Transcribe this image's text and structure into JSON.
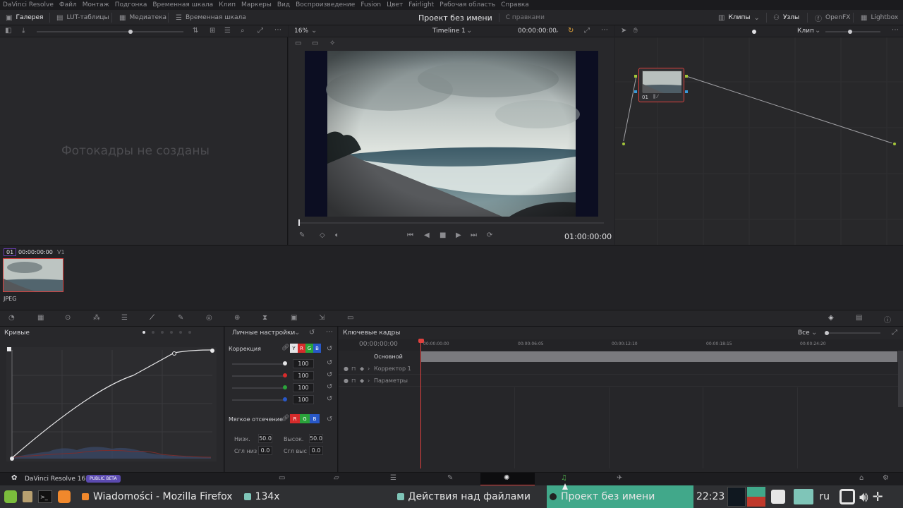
{
  "menu": [
    "DaVinci Resolve",
    "Файл",
    "Монтаж",
    "Подгонка",
    "Временная шкала",
    "Клип",
    "Маркеры",
    "Вид",
    "Воспроизведение",
    "Fusion",
    "Цвет",
    "Fairlight",
    "Рабочая область",
    "Справка"
  ],
  "toolbar": {
    "gallery": "Галерея",
    "lut": "LUT-таблицы",
    "media": "Медиатека",
    "timeline": "Временная шкала",
    "project_title": "Проект без имени",
    "project_status": "С правками",
    "clips": "Клипы",
    "nodes": "Узлы",
    "openfx": "OpenFX",
    "lightbox": "Lightbox"
  },
  "gallery": {
    "empty_text": "Фотокадры не созданы"
  },
  "viewer": {
    "zoom": "16%",
    "timeline_name": "Timeline 1",
    "timecode_top": "00:00:00:00",
    "timecode": "01:00:00:00"
  },
  "nodes": {
    "mode": "Клип",
    "node_label": "01"
  },
  "clipstrip": {
    "clip_num": "01",
    "clip_tc": "00:00:00:00",
    "track": "V1",
    "clip_type": "JPEG"
  },
  "curves": {
    "title": "Кривые"
  },
  "custom": {
    "title": "Личные настройки",
    "correction_label": "Коррекция",
    "channels": [
      "Y",
      "R",
      "G",
      "B"
    ],
    "values": [
      "100",
      "100",
      "100",
      "100"
    ],
    "soft_clip_label": "Мягкое отсечение",
    "low_label": "Низк.",
    "low_value": "50.0",
    "high_label": "Высок.",
    "high_value": "50.0",
    "low_soft_label": "Сгл низ",
    "low_soft_value": "0.0",
    "high_soft_label": "Сгл выс",
    "high_soft_value": "0.0"
  },
  "keyframes": {
    "title": "Ключевые кадры",
    "filter": "Все",
    "timecode": "00:00:00:00",
    "ruler": [
      "00:00:00:00",
      "00:00:06:05",
      "00:00:12:10",
      "00:00:18:15",
      "00:00:24:20"
    ],
    "tracks": [
      "Основной",
      "Корректор 1",
      "Параметры"
    ]
  },
  "pagebar": {
    "app_name": "DaVinci Resolve 16",
    "badge": "PUBLIC BETA"
  },
  "taskbar": {
    "firefox": "Wiadomości - Mozilla Firefox",
    "folder": "134x",
    "files": "Действия над файлами",
    "resolve": "Проект без имени",
    "time": "22:23",
    "lang": "ru"
  },
  "colors": {
    "accent_red": "#e0413e",
    "node_green": "#a4c639",
    "resolve_task": "#41a88a"
  }
}
